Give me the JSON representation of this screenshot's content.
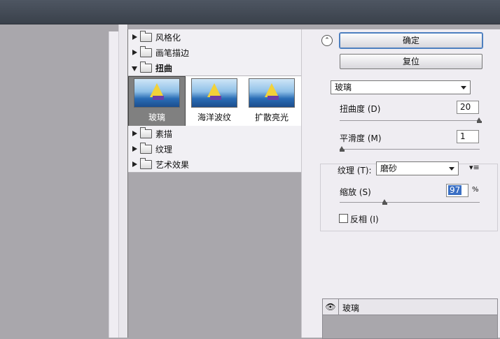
{
  "gallery": {
    "categories": [
      {
        "label": "风格化",
        "expanded": false
      },
      {
        "label": "画笔描边",
        "expanded": false
      },
      {
        "label": "扭曲",
        "expanded": true
      },
      {
        "label": "素描",
        "expanded": false
      },
      {
        "label": "纹理",
        "expanded": false
      },
      {
        "label": "艺术效果",
        "expanded": false
      }
    ],
    "thumbnails": [
      {
        "label": "玻璃",
        "selected": true
      },
      {
        "label": "海洋波纹",
        "selected": false
      },
      {
        "label": "扩散亮光",
        "selected": false
      }
    ]
  },
  "settings": {
    "ok_label": "确定",
    "reset_label": "复位",
    "filter_select": "玻璃",
    "distortion": {
      "label": "扭曲度 (D)",
      "value": "20",
      "level": 20,
      "max": 20
    },
    "smoothness": {
      "label": "平滑度 (M)",
      "value": "1",
      "level": 1,
      "max": 15
    },
    "texture": {
      "label": "纹理 (T):",
      "value": "磨砂"
    },
    "scaling": {
      "label": "缩放 (S)",
      "value": "97",
      "unit": "%",
      "level": 97,
      "min": 50,
      "max": 200
    },
    "invert": {
      "label": "反相 (I)",
      "checked": false
    }
  },
  "layers": {
    "items": [
      {
        "label": "玻璃",
        "visible": true
      }
    ]
  },
  "colors": {
    "accent": "#4d7fbf",
    "selection_bg": "#808080",
    "panel_bg": "#efedf2"
  }
}
